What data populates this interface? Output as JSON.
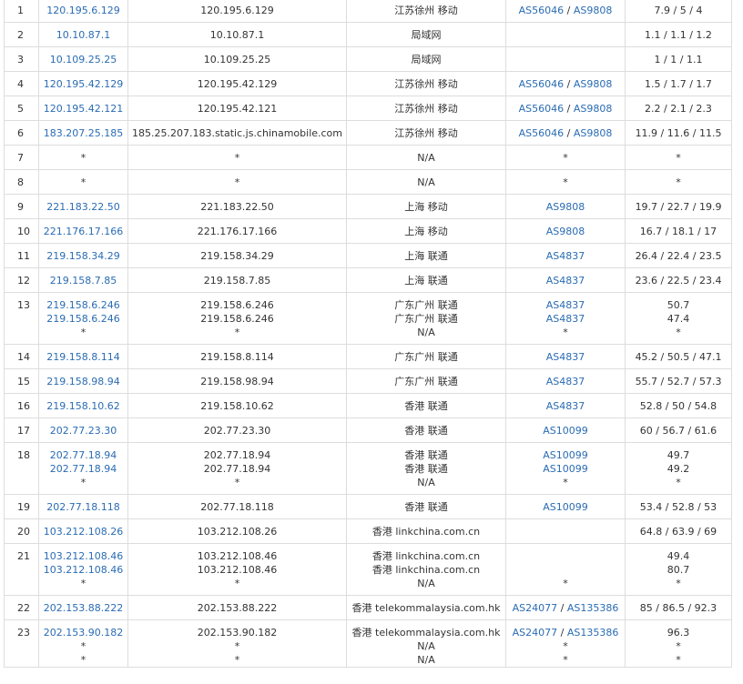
{
  "rows": [
    {
      "hop": "1",
      "ips": [
        "120.195.6.129"
      ],
      "hosts": [
        "120.195.6.129"
      ],
      "locs": [
        "江苏徐州 移动"
      ],
      "as": [
        [
          "AS56046",
          "AS9808"
        ]
      ],
      "times": [
        "7.9 / 5 / 4"
      ]
    },
    {
      "hop": "2",
      "ips": [
        "10.10.87.1"
      ],
      "hosts": [
        "10.10.87.1"
      ],
      "locs": [
        "局域网"
      ],
      "as": [
        []
      ],
      "times": [
        "1.1 / 1.1 / 1.2"
      ]
    },
    {
      "hop": "3",
      "ips": [
        "10.109.25.25"
      ],
      "hosts": [
        "10.109.25.25"
      ],
      "locs": [
        "局域网"
      ],
      "as": [
        []
      ],
      "times": [
        "1 / 1 / 1.1"
      ]
    },
    {
      "hop": "4",
      "ips": [
        "120.195.42.129"
      ],
      "hosts": [
        "120.195.42.129"
      ],
      "locs": [
        "江苏徐州 移动"
      ],
      "as": [
        [
          "AS56046",
          "AS9808"
        ]
      ],
      "times": [
        "1.5 / 1.7 / 1.7"
      ]
    },
    {
      "hop": "5",
      "ips": [
        "120.195.42.121"
      ],
      "hosts": [
        "120.195.42.121"
      ],
      "locs": [
        "江苏徐州 移动"
      ],
      "as": [
        [
          "AS56046",
          "AS9808"
        ]
      ],
      "times": [
        "2.2 / 2.1 / 2.3"
      ]
    },
    {
      "hop": "6",
      "ips": [
        "183.207.25.185"
      ],
      "hosts": [
        "185.25.207.183.static.js.chinamobile.com"
      ],
      "locs": [
        "江苏徐州 移动"
      ],
      "as": [
        [
          "AS56046",
          "AS9808"
        ]
      ],
      "times": [
        "11.9 / 11.6 / 11.5"
      ]
    },
    {
      "hop": "7",
      "ips": [
        "*"
      ],
      "hosts": [
        "*"
      ],
      "locs": [
        "N/A"
      ],
      "as": [
        [
          "*"
        ]
      ],
      "times": [
        "*"
      ]
    },
    {
      "hop": "8",
      "ips": [
        "*"
      ],
      "hosts": [
        "*"
      ],
      "locs": [
        "N/A"
      ],
      "as": [
        [
          "*"
        ]
      ],
      "times": [
        "*"
      ]
    },
    {
      "hop": "9",
      "ips": [
        "221.183.22.50"
      ],
      "hosts": [
        "221.183.22.50"
      ],
      "locs": [
        "上海 移动"
      ],
      "as": [
        [
          "AS9808"
        ]
      ],
      "times": [
        "19.7 / 22.7 / 19.9"
      ]
    },
    {
      "hop": "10",
      "ips": [
        "221.176.17.166"
      ],
      "hosts": [
        "221.176.17.166"
      ],
      "locs": [
        "上海 移动"
      ],
      "as": [
        [
          "AS9808"
        ]
      ],
      "times": [
        "16.7 / 18.1 / 17"
      ]
    },
    {
      "hop": "11",
      "ips": [
        "219.158.34.29"
      ],
      "hosts": [
        "219.158.34.29"
      ],
      "locs": [
        "上海 联通"
      ],
      "as": [
        [
          "AS4837"
        ]
      ],
      "times": [
        "26.4 / 22.4 / 23.5"
      ]
    },
    {
      "hop": "12",
      "ips": [
        "219.158.7.85"
      ],
      "hosts": [
        "219.158.7.85"
      ],
      "locs": [
        "上海 联通"
      ],
      "as": [
        [
          "AS4837"
        ]
      ],
      "times": [
        "23.6 / 22.5 / 23.4"
      ]
    },
    {
      "hop": "13",
      "ips": [
        "219.158.6.246",
        "219.158.6.246",
        "*"
      ],
      "hosts": [
        "219.158.6.246",
        "219.158.6.246",
        "*"
      ],
      "locs": [
        "广东广州 联通",
        "广东广州 联通",
        "N/A"
      ],
      "as": [
        [
          "AS4837"
        ],
        [
          "AS4837"
        ],
        [
          "*"
        ]
      ],
      "times": [
        "50.7",
        "47.4",
        "*"
      ]
    },
    {
      "hop": "14",
      "ips": [
        "219.158.8.114"
      ],
      "hosts": [
        "219.158.8.114"
      ],
      "locs": [
        "广东广州 联通"
      ],
      "as": [
        [
          "AS4837"
        ]
      ],
      "times": [
        "45.2 / 50.5 / 47.1"
      ]
    },
    {
      "hop": "15",
      "ips": [
        "219.158.98.94"
      ],
      "hosts": [
        "219.158.98.94"
      ],
      "locs": [
        "广东广州 联通"
      ],
      "as": [
        [
          "AS4837"
        ]
      ],
      "times": [
        "55.7 / 52.7 / 57.3"
      ]
    },
    {
      "hop": "16",
      "ips": [
        "219.158.10.62"
      ],
      "hosts": [
        "219.158.10.62"
      ],
      "locs": [
        "香港 联通"
      ],
      "as": [
        [
          "AS4837"
        ]
      ],
      "times": [
        "52.8 / 50 / 54.8"
      ]
    },
    {
      "hop": "17",
      "ips": [
        "202.77.23.30"
      ],
      "hosts": [
        "202.77.23.30"
      ],
      "locs": [
        "香港 联通"
      ],
      "as": [
        [
          "AS10099"
        ]
      ],
      "times": [
        "60 / 56.7 / 61.6"
      ]
    },
    {
      "hop": "18",
      "ips": [
        "202.77.18.94",
        "202.77.18.94",
        "*"
      ],
      "hosts": [
        "202.77.18.94",
        "202.77.18.94",
        "*"
      ],
      "locs": [
        "香港 联通",
        "香港 联通",
        "N/A"
      ],
      "as": [
        [
          "AS10099"
        ],
        [
          "AS10099"
        ],
        [
          "*"
        ]
      ],
      "times": [
        "49.7",
        "49.2",
        "*"
      ]
    },
    {
      "hop": "19",
      "ips": [
        "202.77.18.118"
      ],
      "hosts": [
        "202.77.18.118"
      ],
      "locs": [
        "香港 联通"
      ],
      "as": [
        [
          "AS10099"
        ]
      ],
      "times": [
        "53.4 / 52.8 / 53"
      ]
    },
    {
      "hop": "20",
      "ips": [
        "103.212.108.26"
      ],
      "hosts": [
        "103.212.108.26"
      ],
      "locs": [
        "香港 linkchina.com.cn"
      ],
      "as": [
        []
      ],
      "times": [
        "64.8 / 63.9 / 69"
      ]
    },
    {
      "hop": "21",
      "ips": [
        "103.212.108.46",
        "103.212.108.46",
        "*"
      ],
      "hosts": [
        "103.212.108.46",
        "103.212.108.46",
        "*"
      ],
      "locs": [
        "香港 linkchina.com.cn",
        "香港 linkchina.com.cn",
        "N/A"
      ],
      "as": [
        [],
        [],
        [
          "*"
        ]
      ],
      "times": [
        "49.4",
        "80.7",
        "*"
      ]
    },
    {
      "hop": "22",
      "ips": [
        "202.153.88.222"
      ],
      "hosts": [
        "202.153.88.222"
      ],
      "locs": [
        "香港 telekommalaysia.com.hk"
      ],
      "as": [
        [
          "AS24077",
          "AS135386"
        ]
      ],
      "times": [
        "85 / 86.5 / 92.3"
      ]
    },
    {
      "hop": "23",
      "ips": [
        "202.153.90.182",
        "*",
        "*"
      ],
      "hosts": [
        "202.153.90.182",
        "*",
        "*"
      ],
      "locs": [
        "香港 telekommalaysia.com.hk",
        "N/A",
        "N/A"
      ],
      "as": [
        [
          "AS24077",
          "AS135386"
        ],
        [
          "*"
        ],
        [
          "*"
        ]
      ],
      "times": [
        "96.3",
        "*",
        "*"
      ]
    }
  ]
}
